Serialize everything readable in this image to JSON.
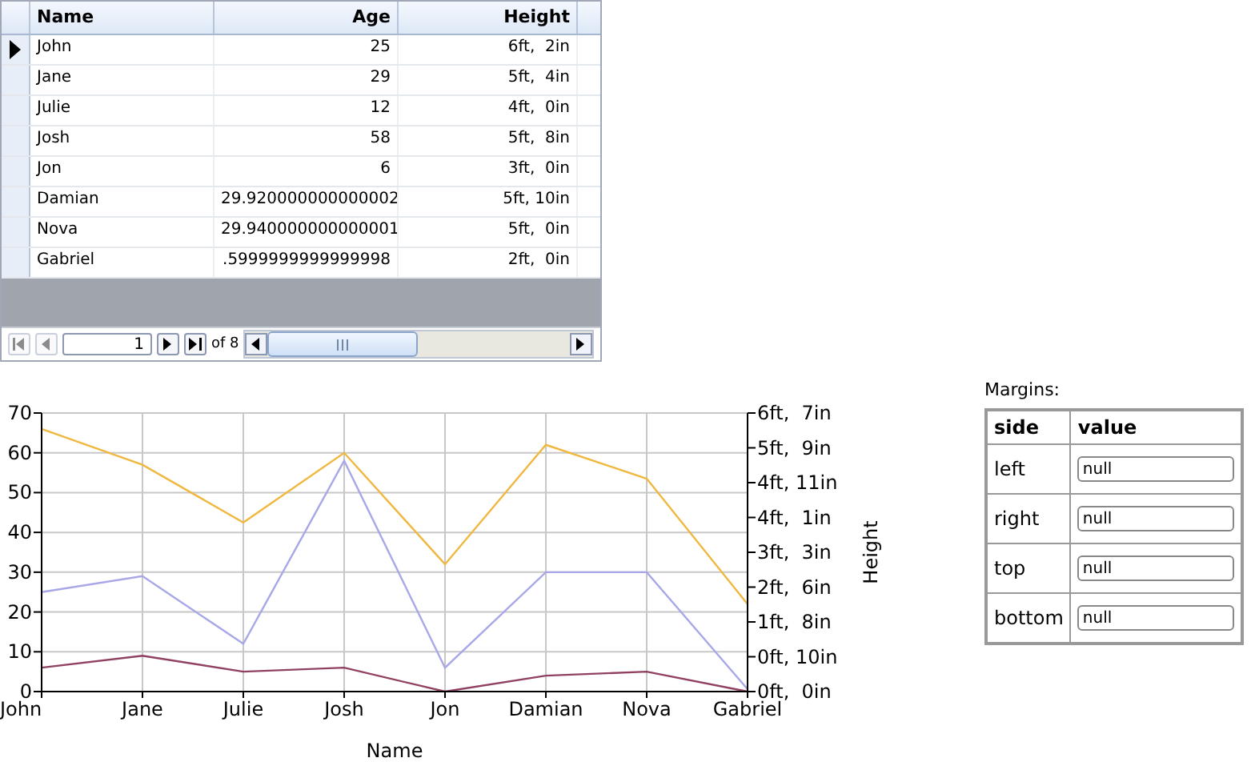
{
  "grid": {
    "columns": [
      "Name",
      "Age",
      "Height"
    ],
    "rows": [
      {
        "cells": [
          "John",
          "25",
          "6ft,  2in"
        ],
        "current": true
      },
      {
        "cells": [
          "Jane",
          "29",
          "5ft,  4in"
        ],
        "current": false
      },
      {
        "cells": [
          "Julie",
          "12",
          "4ft,  0in"
        ],
        "current": false
      },
      {
        "cells": [
          "Josh",
          "58",
          "5ft,  8in"
        ],
        "current": false
      },
      {
        "cells": [
          "Jon",
          "6",
          "3ft,  0in"
        ],
        "current": false
      },
      {
        "cells": [
          "Damian",
          "29.920000000000002",
          "5ft, 10in"
        ],
        "current": false
      },
      {
        "cells": [
          "Nova",
          "29.940000000000001",
          "5ft,  0in"
        ],
        "current": false
      },
      {
        "cells": [
          "Gabriel",
          ".5999999999999998",
          "2ft,  0in"
        ],
        "current": false
      }
    ],
    "navigator": {
      "page": "1",
      "of": "of 8"
    }
  },
  "chart": {
    "chart_data": {
      "type": "line",
      "xlabel": "Name",
      "categories": [
        "John",
        "Jane",
        "Julie",
        "Josh",
        "Jon",
        "Damian",
        "Nova",
        "Gabriel"
      ],
      "series": [
        {
          "color": "#f0b840",
          "values": [
            66,
            57,
            42.5,
            60,
            32,
            62,
            53.5,
            22
          ]
        },
        {
          "color": "#a8a8e8",
          "values": [
            25,
            29,
            12,
            58,
            6,
            30,
            30,
            0.6
          ]
        },
        {
          "color": "#904060",
          "values": [
            6,
            9,
            5,
            6,
            0,
            4,
            5,
            0
          ]
        }
      ],
      "ylim": [
        0,
        70
      ],
      "yticks": [
        0,
        10,
        20,
        30,
        40,
        50,
        60,
        70
      ],
      "grid": true
    },
    "right_axis": {
      "title": "Height",
      "labels": [
        "6ft,  7in",
        "5ft,  9in",
        "4ft, 11in",
        "4ft,  1in",
        "3ft,  3in",
        "2ft,  6in",
        "1ft,  8in",
        "0ft, 10in",
        "0ft,  0in"
      ]
    }
  },
  "margins": {
    "title": "Margins:",
    "columns": [
      "side",
      "value"
    ],
    "rows": [
      {
        "side": "left",
        "value": "null"
      },
      {
        "side": "right",
        "value": "null"
      },
      {
        "side": "top",
        "value": "null"
      },
      {
        "side": "bottom",
        "value": "null"
      }
    ]
  }
}
